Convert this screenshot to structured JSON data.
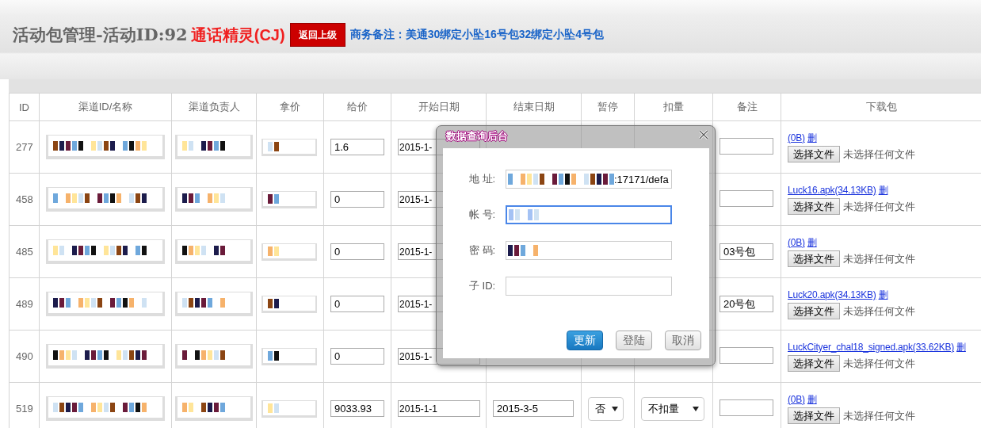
{
  "header": {
    "title": "活动包管理-活动ID:92",
    "app_name": "通话精灵(CJ)",
    "back_button": "返回上级",
    "note": "商务备注：美通30绑定小坠16号包32绑定小坠4号包"
  },
  "table": {
    "columns": [
      "ID",
      "渠道ID/名称",
      "渠道负责人",
      "拿价",
      "给价",
      "开始日期",
      "结束日期",
      "暂停",
      "扣量",
      "备注",
      "下载包"
    ],
    "rows": [
      {
        "id": "277",
        "give_price": "1.6",
        "start_date": "2015-1-",
        "file_link": "(0B)",
        "delete": "删",
        "choose_file": "选择文件",
        "no_file": "未选择任何文件"
      },
      {
        "id": "458",
        "give_price": "0",
        "start_date": "2015-1-",
        "file_link": "Luck16.apk(34.13KB)",
        "delete": "删",
        "choose_file": "选择文件",
        "no_file": "未选择任何文件"
      },
      {
        "id": "485",
        "give_price": "0",
        "start_date": "2015-1-",
        "remark": "03号包",
        "file_link": "(0B)",
        "delete": "删",
        "choose_file": "选择文件",
        "no_file": "未选择任何文件"
      },
      {
        "id": "489",
        "give_price": "0",
        "start_date": "2015-1-",
        "remark": "20号包",
        "file_link": "Luck20.apk(34.13KB)",
        "delete": "删",
        "choose_file": "选择文件",
        "no_file": "未选择任何文件"
      },
      {
        "id": "490",
        "give_price": "0",
        "start_date": "2015-1-",
        "file_link": "LuckCityer_chal18_signed.apk(33.62KB)",
        "delete": "删",
        "choose_file": "选择文件",
        "no_file": "未选择任何文件"
      },
      {
        "id": "519",
        "give_price": "9033.93",
        "start_date": "2015-1-1",
        "end_date": "2015-3-5",
        "paused": "否",
        "deduct": "不扣量",
        "file_link": "(0B)",
        "delete": "删",
        "choose_file": "选择文件",
        "no_file": "未选择任何文件"
      }
    ]
  },
  "dialog": {
    "title": "数据查询后台",
    "fields": [
      {
        "label": "地 址:",
        "value": ":17171/defa",
        "focused": false
      },
      {
        "label": "帐 号:",
        "focused": true
      },
      {
        "label": "密 码:",
        "focused": false
      },
      {
        "label": "子 ID:",
        "focused": false
      }
    ],
    "buttons": [
      {
        "label": "更新",
        "kind": "primary"
      },
      {
        "label": "登陆",
        "kind": "default"
      },
      {
        "label": "取消",
        "kind": "default"
      }
    ]
  }
}
